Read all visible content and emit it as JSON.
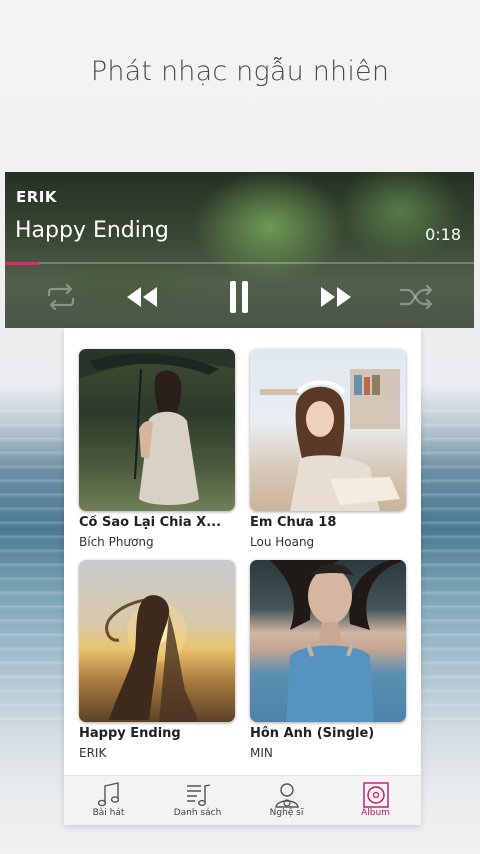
{
  "page": {
    "title": "Phát nhạc ngẫu nhiên"
  },
  "player": {
    "artist": "ERIK",
    "song": "Happy Ending",
    "time": "0:18",
    "progress_fraction": 0.073,
    "accent_color": "#e8266d",
    "icons": [
      "repeat-icon",
      "previous-icon",
      "pause-icon",
      "next-icon",
      "shuffle-icon"
    ]
  },
  "albums": [
    {
      "title": "Cố Sao Lại Chia X...",
      "artist": "Bích Phương"
    },
    {
      "title": "Em Chưa 18",
      "artist": "Lou Hoang"
    },
    {
      "title": "Happy Ending",
      "artist": "ERIK"
    },
    {
      "title": "Hôn Anh (Single)",
      "artist": "MIN"
    }
  ],
  "tabs": [
    {
      "label": "Bài hát",
      "icon": "music-note-icon"
    },
    {
      "label": "Danh sách",
      "icon": "playlist-icon"
    },
    {
      "label": "Nghệ sĩ",
      "icon": "artist-icon"
    },
    {
      "label": "Album",
      "icon": "album-icon",
      "active": true
    }
  ],
  "colors": {
    "active_tab": "#c2185b"
  }
}
